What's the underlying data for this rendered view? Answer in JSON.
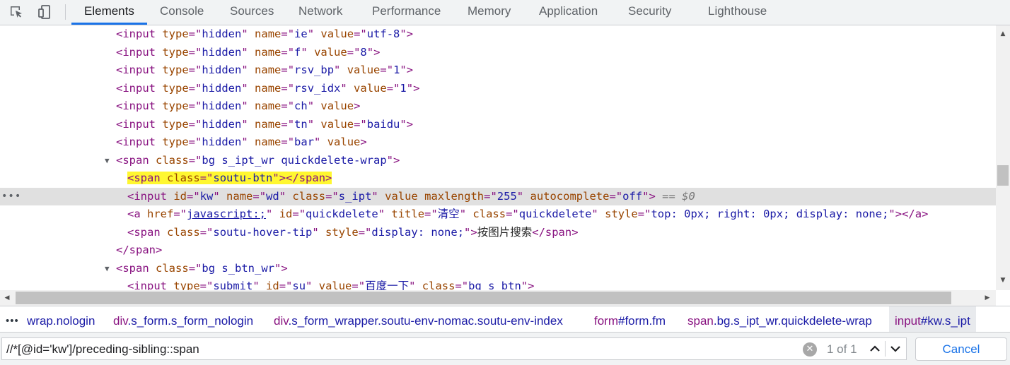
{
  "toolbar": {
    "tabs": [
      {
        "label": "Elements",
        "active": true
      },
      {
        "label": "Console"
      },
      {
        "label": "Sources"
      },
      {
        "label": "Network"
      },
      {
        "label": "Performance"
      },
      {
        "label": "Memory"
      },
      {
        "label": "Application"
      },
      {
        "label": "Security"
      },
      {
        "label": "Lighthouse"
      }
    ]
  },
  "dom": {
    "selected_ref": "== $0",
    "lines": [
      {
        "type": "input",
        "name": "ie",
        "value": "utf-8"
      },
      {
        "type": "input",
        "name": "f",
        "value": "8"
      },
      {
        "type": "input",
        "name": "rsv_bp",
        "value": "1"
      },
      {
        "type": "input",
        "name": "rsv_idx",
        "value": "1"
      },
      {
        "type": "input",
        "name": "ch"
      },
      {
        "type": "input",
        "name": "tn",
        "value": "baidu"
      },
      {
        "type": "input",
        "name": "bar"
      },
      {
        "type": "span-open",
        "class": "bg s_ipt_wr quickdelete-wrap"
      },
      {
        "type": "span-hl",
        "class": "soutu-btn"
      },
      {
        "type": "input-kw",
        "id": "kw",
        "name": "wd",
        "class": "s_ipt",
        "maxlength": "255",
        "autocomplete": "off"
      },
      {
        "type": "a",
        "href": "javascript:;",
        "id": "quickdelete",
        "title": "清空",
        "class": "quickdelete",
        "style": "top: 0px; right: 0px; display: none;"
      },
      {
        "type": "span-tip",
        "class": "soutu-hover-tip",
        "style": "display: none;",
        "text": "按图片搜索"
      },
      {
        "type": "close",
        "tag": "span"
      },
      {
        "type": "span-open",
        "class": "bg s_btn_wr"
      },
      {
        "type": "submit",
        "id": "su",
        "value": "百度一下",
        "class": "bg s_btn"
      }
    ]
  },
  "breadcrumb": {
    "items": [
      {
        "tag": "",
        "cls": "wrap.nologin"
      },
      {
        "tag": "div",
        "cls": ".s_form.s_form_nologin"
      },
      {
        "tag": "div",
        "cls": ".s_form_wrapper.soutu-env-nomac.soutu-env-index"
      },
      {
        "tag": "form",
        "cls": "#form.fm"
      },
      {
        "tag": "span",
        "cls": ".bg.s_ipt_wr.quickdelete-wrap"
      },
      {
        "tag": "input",
        "cls": "#kw.s_ipt",
        "selected": true
      }
    ]
  },
  "search": {
    "value": "//*[@id='kw']/preceding-sibling::span",
    "match_count": "1 of 1",
    "cancel_label": "Cancel"
  },
  "colors": {
    "tag": "#881280",
    "attr_name": "#994500",
    "attr_value": "#1a1aa6",
    "highlight": "#fff730",
    "accent": "#1a73e8"
  }
}
